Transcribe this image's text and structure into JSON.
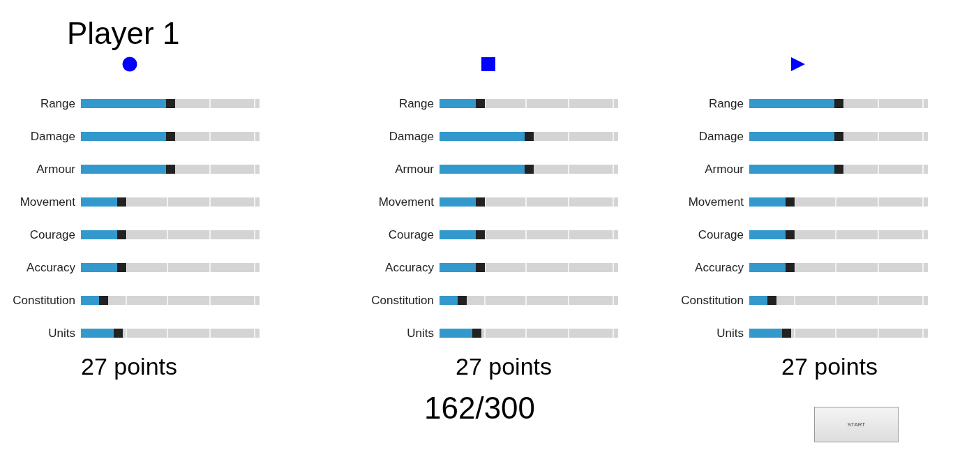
{
  "title": "Player 1",
  "players": [
    {
      "kind": "circle",
      "points": "27 points",
      "stats": [
        {
          "label": "Range",
          "level": 0.5
        },
        {
          "label": "Damage",
          "level": 0.5
        },
        {
          "label": "Armour",
          "level": 0.5
        },
        {
          "label": "Movement",
          "level": 0.23
        },
        {
          "label": "Courage",
          "level": 0.23
        },
        {
          "label": "Accuracy",
          "level": 0.23
        },
        {
          "label": "Constitution",
          "level": 0.125
        },
        {
          "label": "Units",
          "level": 0.21
        }
      ]
    },
    {
      "kind": "square",
      "points": "27 points",
      "stats": [
        {
          "label": "Range",
          "level": 0.23
        },
        {
          "label": "Damage",
          "level": 0.5
        },
        {
          "label": "Armour",
          "level": 0.5
        },
        {
          "label": "Movement",
          "level": 0.23
        },
        {
          "label": "Courage",
          "level": 0.23
        },
        {
          "label": "Accuracy",
          "level": 0.23
        },
        {
          "label": "Constitution",
          "level": 0.125
        },
        {
          "label": "Units",
          "level": 0.21
        }
      ]
    },
    {
      "kind": "triangle",
      "points": "27 points",
      "stats": [
        {
          "label": "Range",
          "level": 0.5
        },
        {
          "label": "Damage",
          "level": 0.5
        },
        {
          "label": "Armour",
          "level": 0.5
        },
        {
          "label": "Movement",
          "level": 0.23
        },
        {
          "label": "Courage",
          "level": 0.23
        },
        {
          "label": "Accuracy",
          "level": 0.23
        },
        {
          "label": "Constitution",
          "level": 0.125
        },
        {
          "label": "Units",
          "level": 0.21
        }
      ]
    }
  ],
  "total": "162/300",
  "start_button": "START"
}
